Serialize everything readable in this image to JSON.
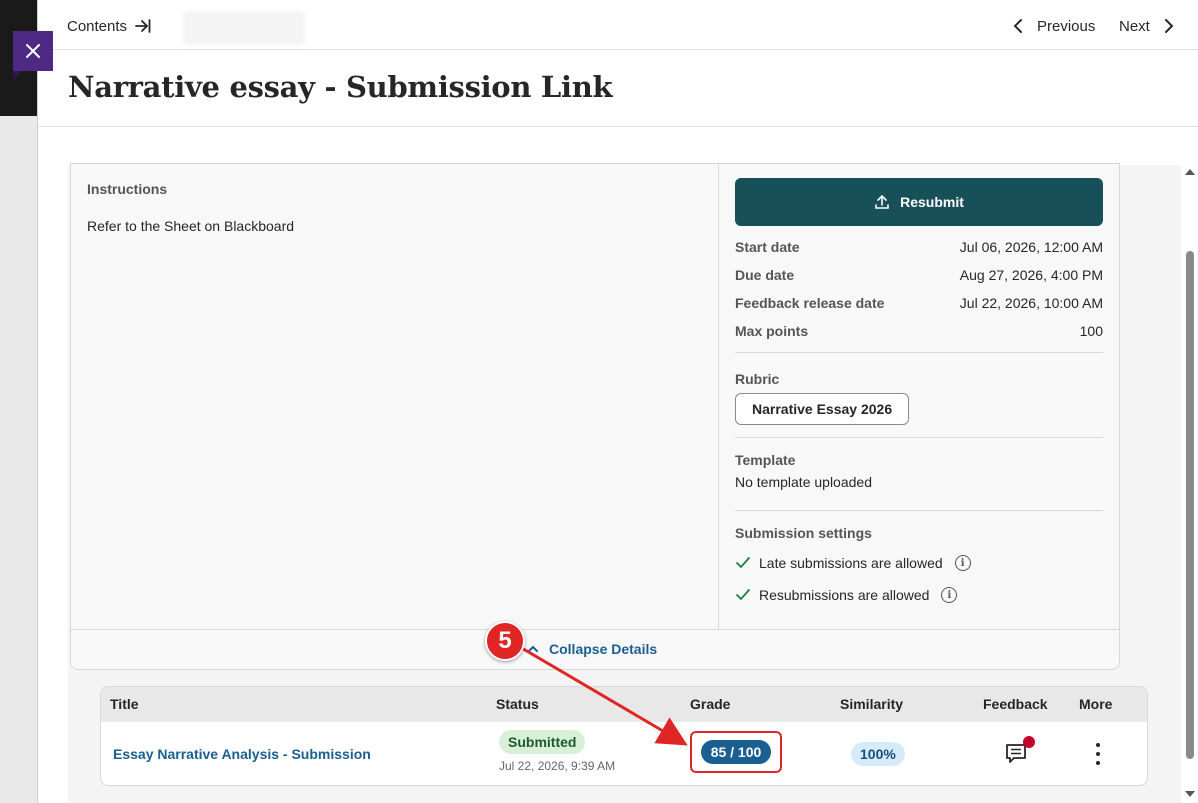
{
  "topbar": {
    "contents_label": "Contents",
    "previous_label": "Previous",
    "next_label": "Next"
  },
  "page": {
    "title": "Narrative essay - Submission Link"
  },
  "instructions": {
    "label": "Instructions",
    "text": "Refer to the Sheet on Blackboard"
  },
  "side": {
    "resubmit_label": "Resubmit",
    "meta": [
      {
        "key": "Start date",
        "value": "Jul 06, 2026, 12:00 AM"
      },
      {
        "key": "Due date",
        "value": "Aug 27, 2026, 4:00 PM"
      },
      {
        "key": "Feedback release date",
        "value": "Jul 22, 2026, 10:00 AM"
      },
      {
        "key": "Max points",
        "value": "100"
      }
    ],
    "rubric_label": "Rubric",
    "rubric_name": "Narrative Essay 2026",
    "template_label": "Template",
    "template_value": "No template uploaded",
    "settings_label": "Submission settings",
    "settings": [
      {
        "text": "Late submissions are allowed"
      },
      {
        "text": "Resubmissions are allowed"
      }
    ]
  },
  "collapse_label": "Collapse Details",
  "annotation": {
    "step_number": "5",
    "color": "#e02525"
  },
  "table": {
    "headers": {
      "title": "Title",
      "status": "Status",
      "grade": "Grade",
      "similarity": "Similarity",
      "feedback": "Feedback",
      "more": "More"
    },
    "rows": [
      {
        "title": "Essay Narrative Analysis - Submission",
        "status": "Submitted",
        "status_date": "Jul 22, 2026, 9:39 AM",
        "grade": "85 / 100",
        "similarity": "100%"
      }
    ]
  },
  "colors": {
    "accent": "#185059",
    "link": "#1a5e92",
    "close_button": "#4e2a84",
    "notification": "#c4002d"
  }
}
